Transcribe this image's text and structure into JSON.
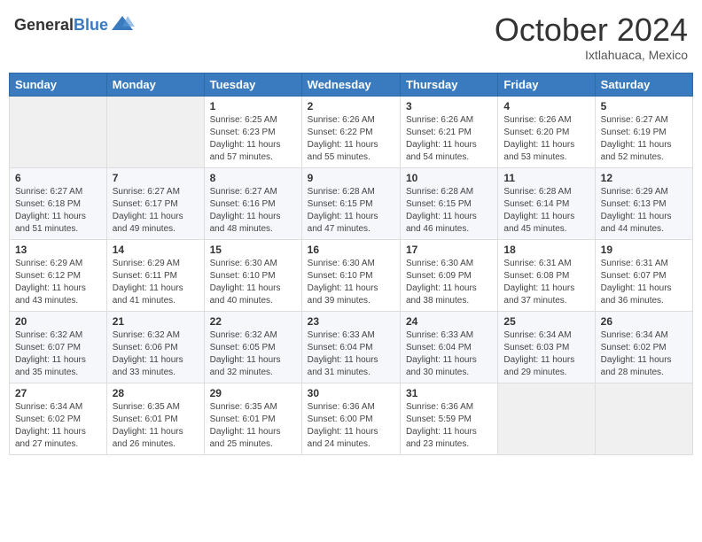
{
  "header": {
    "logo_general": "General",
    "logo_blue": "Blue",
    "month": "October 2024",
    "location": "Ixtlahuaca, Mexico"
  },
  "days_of_week": [
    "Sunday",
    "Monday",
    "Tuesday",
    "Wednesday",
    "Thursday",
    "Friday",
    "Saturday"
  ],
  "weeks": [
    [
      {
        "day": "",
        "info": ""
      },
      {
        "day": "",
        "info": ""
      },
      {
        "day": "1",
        "info": "Sunrise: 6:25 AM\nSunset: 6:23 PM\nDaylight: 11 hours and 57 minutes."
      },
      {
        "day": "2",
        "info": "Sunrise: 6:26 AM\nSunset: 6:22 PM\nDaylight: 11 hours and 55 minutes."
      },
      {
        "day": "3",
        "info": "Sunrise: 6:26 AM\nSunset: 6:21 PM\nDaylight: 11 hours and 54 minutes."
      },
      {
        "day": "4",
        "info": "Sunrise: 6:26 AM\nSunset: 6:20 PM\nDaylight: 11 hours and 53 minutes."
      },
      {
        "day": "5",
        "info": "Sunrise: 6:27 AM\nSunset: 6:19 PM\nDaylight: 11 hours and 52 minutes."
      }
    ],
    [
      {
        "day": "6",
        "info": "Sunrise: 6:27 AM\nSunset: 6:18 PM\nDaylight: 11 hours and 51 minutes."
      },
      {
        "day": "7",
        "info": "Sunrise: 6:27 AM\nSunset: 6:17 PM\nDaylight: 11 hours and 49 minutes."
      },
      {
        "day": "8",
        "info": "Sunrise: 6:27 AM\nSunset: 6:16 PM\nDaylight: 11 hours and 48 minutes."
      },
      {
        "day": "9",
        "info": "Sunrise: 6:28 AM\nSunset: 6:15 PM\nDaylight: 11 hours and 47 minutes."
      },
      {
        "day": "10",
        "info": "Sunrise: 6:28 AM\nSunset: 6:15 PM\nDaylight: 11 hours and 46 minutes."
      },
      {
        "day": "11",
        "info": "Sunrise: 6:28 AM\nSunset: 6:14 PM\nDaylight: 11 hours and 45 minutes."
      },
      {
        "day": "12",
        "info": "Sunrise: 6:29 AM\nSunset: 6:13 PM\nDaylight: 11 hours and 44 minutes."
      }
    ],
    [
      {
        "day": "13",
        "info": "Sunrise: 6:29 AM\nSunset: 6:12 PM\nDaylight: 11 hours and 43 minutes."
      },
      {
        "day": "14",
        "info": "Sunrise: 6:29 AM\nSunset: 6:11 PM\nDaylight: 11 hours and 41 minutes."
      },
      {
        "day": "15",
        "info": "Sunrise: 6:30 AM\nSunset: 6:10 PM\nDaylight: 11 hours and 40 minutes."
      },
      {
        "day": "16",
        "info": "Sunrise: 6:30 AM\nSunset: 6:10 PM\nDaylight: 11 hours and 39 minutes."
      },
      {
        "day": "17",
        "info": "Sunrise: 6:30 AM\nSunset: 6:09 PM\nDaylight: 11 hours and 38 minutes."
      },
      {
        "day": "18",
        "info": "Sunrise: 6:31 AM\nSunset: 6:08 PM\nDaylight: 11 hours and 37 minutes."
      },
      {
        "day": "19",
        "info": "Sunrise: 6:31 AM\nSunset: 6:07 PM\nDaylight: 11 hours and 36 minutes."
      }
    ],
    [
      {
        "day": "20",
        "info": "Sunrise: 6:32 AM\nSunset: 6:07 PM\nDaylight: 11 hours and 35 minutes."
      },
      {
        "day": "21",
        "info": "Sunrise: 6:32 AM\nSunset: 6:06 PM\nDaylight: 11 hours and 33 minutes."
      },
      {
        "day": "22",
        "info": "Sunrise: 6:32 AM\nSunset: 6:05 PM\nDaylight: 11 hours and 32 minutes."
      },
      {
        "day": "23",
        "info": "Sunrise: 6:33 AM\nSunset: 6:04 PM\nDaylight: 11 hours and 31 minutes."
      },
      {
        "day": "24",
        "info": "Sunrise: 6:33 AM\nSunset: 6:04 PM\nDaylight: 11 hours and 30 minutes."
      },
      {
        "day": "25",
        "info": "Sunrise: 6:34 AM\nSunset: 6:03 PM\nDaylight: 11 hours and 29 minutes."
      },
      {
        "day": "26",
        "info": "Sunrise: 6:34 AM\nSunset: 6:02 PM\nDaylight: 11 hours and 28 minutes."
      }
    ],
    [
      {
        "day": "27",
        "info": "Sunrise: 6:34 AM\nSunset: 6:02 PM\nDaylight: 11 hours and 27 minutes."
      },
      {
        "day": "28",
        "info": "Sunrise: 6:35 AM\nSunset: 6:01 PM\nDaylight: 11 hours and 26 minutes."
      },
      {
        "day": "29",
        "info": "Sunrise: 6:35 AM\nSunset: 6:01 PM\nDaylight: 11 hours and 25 minutes."
      },
      {
        "day": "30",
        "info": "Sunrise: 6:36 AM\nSunset: 6:00 PM\nDaylight: 11 hours and 24 minutes."
      },
      {
        "day": "31",
        "info": "Sunrise: 6:36 AM\nSunset: 5:59 PM\nDaylight: 11 hours and 23 minutes."
      },
      {
        "day": "",
        "info": ""
      },
      {
        "day": "",
        "info": ""
      }
    ]
  ]
}
